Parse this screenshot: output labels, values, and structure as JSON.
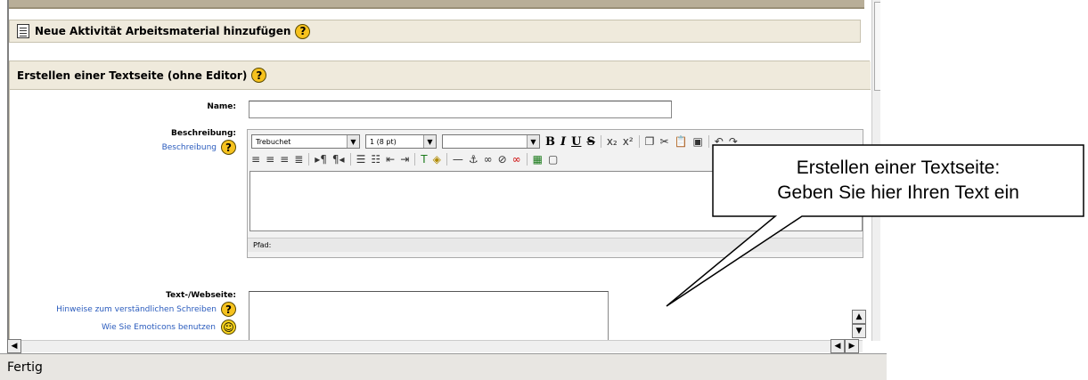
{
  "section": {
    "title": "Neue Aktivität Arbeitsmaterial hinzufügen",
    "help": "?"
  },
  "form": {
    "title": "Erstellen einer Textseite (ohne Editor)",
    "help": "?",
    "name_label": "Name:",
    "name_value": "",
    "description_label": "Beschreibung:",
    "description_link": "Beschreibung",
    "editor": {
      "font": "Trebuchet",
      "size": "1 (8 pt)",
      "style": "",
      "bold": "B",
      "italic": "I",
      "underline": "U",
      "strike": "S",
      "path_label": "Pfad:"
    },
    "text_label": "Text-/Webseite:",
    "hint_link": "Hinweise zum verständlichen Schreiben",
    "emoticon_link": "Wie Sie Emoticons benutzen"
  },
  "status": {
    "text": "Fertig"
  },
  "callout": {
    "line1": "Erstellen einer Textseite:",
    "line2": "Geben Sie hier Ihren Text ein"
  }
}
